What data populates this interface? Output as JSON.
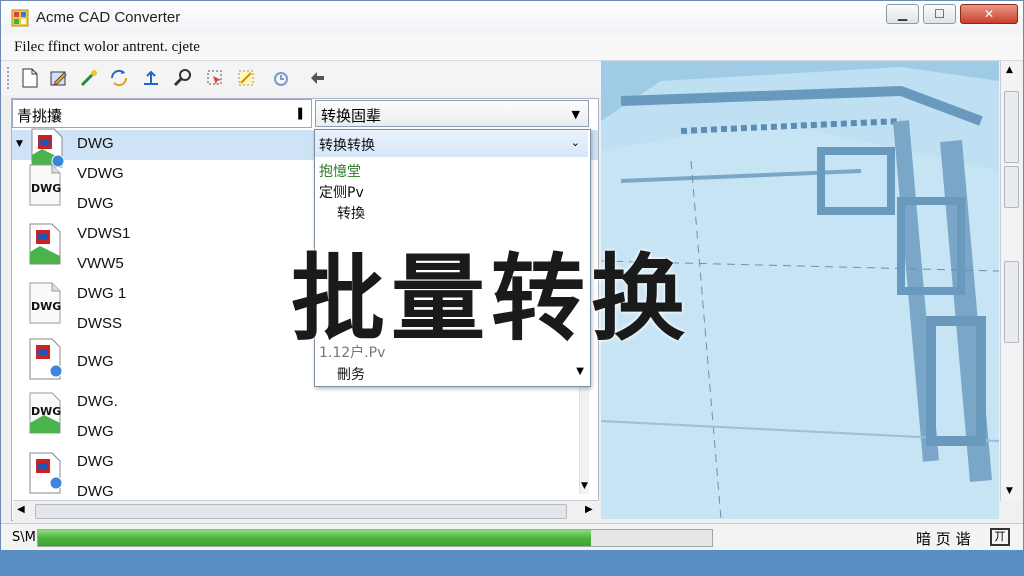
{
  "window": {
    "title": "Acme CAD Converter",
    "minimize_label": "▁",
    "maximize_label": "☐",
    "close_label": "✕"
  },
  "menu": {
    "text": "Filec  ffinct wolor antrent.  cjete"
  },
  "toolbar": {
    "icons": [
      "new-file-icon",
      "edit-icon",
      "wand-icon",
      "convert-icon",
      "batch-icon",
      "zoom-icon",
      "magic-icon",
      "history-icon",
      "back-arrow-icon"
    ]
  },
  "filter": {
    "left_value": "青挑攮",
    "combo_value": "转换固辈"
  },
  "file_list": [
    {
      "label": "DWG",
      "selected": true
    },
    {
      "label": "VDWG"
    },
    {
      "label": "DWG"
    },
    {
      "label": "VDWS1"
    },
    {
      "label": "VWW5"
    },
    {
      "label": "DWG 1"
    },
    {
      "label": "DWSS"
    },
    {
      "label": "DWG"
    },
    {
      "label": "DWG."
    },
    {
      "label": "DWG"
    },
    {
      "label": "DWG"
    },
    {
      "label": "DWG"
    }
  ],
  "dropdown": {
    "top_value": "转换转换",
    "items": [
      "抱憶堂",
      "定侧Pv",
      "转換",
      "1.12户.Pv",
      "刪务"
    ]
  },
  "status": {
    "left_label": "S\\M",
    "progress_fraction": 0.82,
    "right_label": "暗 页 谐",
    "icon_label": "丌"
  },
  "overlay_text": "批量转换",
  "colors": {
    "accent": "#3da232",
    "selection": "#cfe3f7",
    "preview_bg": "#bfe0f2"
  }
}
